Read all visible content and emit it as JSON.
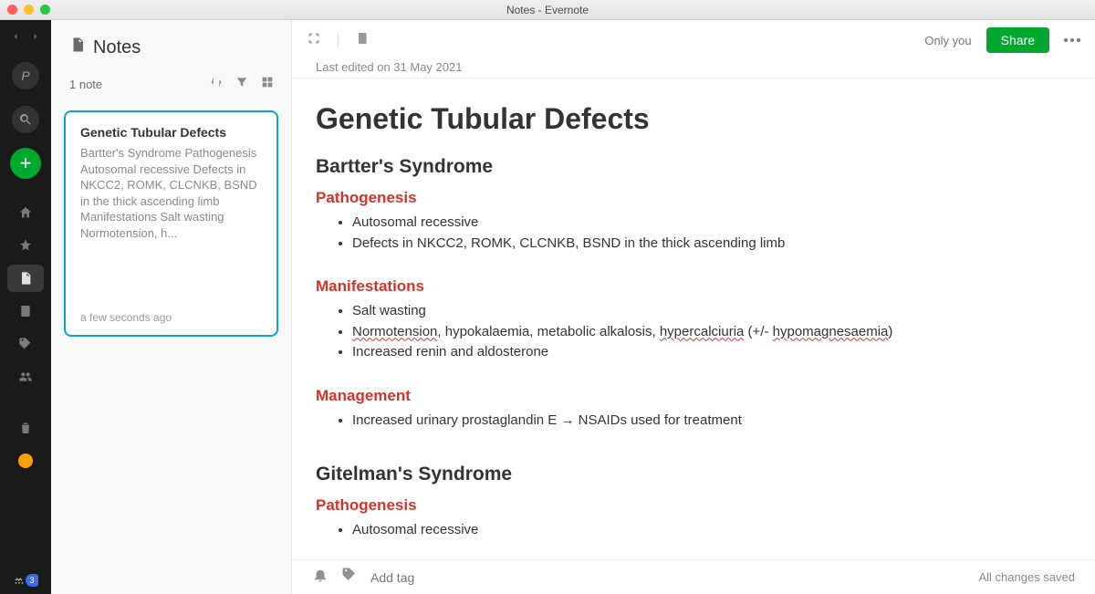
{
  "window": {
    "title": "Notes - Evernote"
  },
  "rail": {
    "sync_count": "3"
  },
  "notelist": {
    "title": "Notes",
    "count": "1 note",
    "card": {
      "title": "Genetic Tubular Defects",
      "preview": "Bartter's Syndrome Pathogenesis Autosomal recessive Defects in NKCC2, ROMK, CLCNKB, BSND in the thick ascending limb Manifestations Salt wasting Normotension, h...",
      "time": "a few seconds ago"
    }
  },
  "editor": {
    "only_you": "Only you",
    "share": "Share",
    "last_edited": "Last edited on 31 May 2021",
    "doc_title": "Genetic Tubular Defects",
    "sections": {
      "bartter_heading": "Bartter's Syndrome",
      "pathogenesis_label": "Pathogenesis",
      "bartter_path_1": "Autosomal recessive",
      "bartter_path_2": "Defects in NKCC2, ROMK, CLCNKB, BSND in the thick ascending limb",
      "manifestations_label": "Manifestations",
      "bartter_man_1": "Salt wasting",
      "bartter_man_3": "Increased renin and aldosterone",
      "management_label": "Management",
      "bartter_mgmt_1": "Increased urinary prostaglandin E → NSAIDs used for treatment",
      "gitelman_heading": "Gitelman's Syndrome",
      "gitel_path_1": "Autosomal recessive"
    },
    "man2": {
      "normo": "Normotension",
      "mid": ", hypokalaemia, metabolic alkalosis, ",
      "hyperc": "hypercalciuria",
      "paren1": " (+/- ",
      "hypomg": "hypomagnesaemia",
      "paren2": ")"
    },
    "tag_placeholder": "Add tag",
    "saved": "All changes saved"
  }
}
